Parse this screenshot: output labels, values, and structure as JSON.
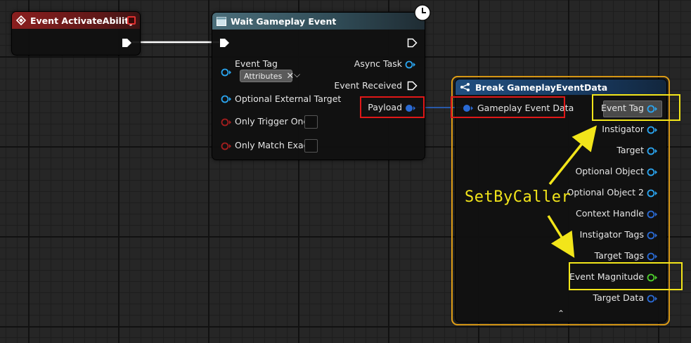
{
  "colors": {
    "event_header": "#7a1d1d",
    "wait_header": "#3e5e6a",
    "break_header": "#204a78",
    "selection_border": "#e8a417",
    "highlight_red": "#e01818",
    "highlight_yellow": "#f2e51a",
    "pin_blue": "#2aa5f0",
    "pin_green": "#4ed12c",
    "pin_red": "#a51e1e",
    "exec_white": "#ffffff"
  },
  "event_node": {
    "title": "Event ActivateAbility",
    "icon": "event-diamond-icon"
  },
  "wait_node": {
    "title": "Wait Gameplay Event",
    "icon": "function-icon",
    "latent_icon": "clock-icon",
    "event_tag_label": "Event Tag",
    "event_tag_value": "Attributes",
    "optional_external_target_label": "Optional External Target",
    "only_trigger_once_label": "Only Trigger Once",
    "only_match_exact_label": "Only Match Exact",
    "async_task_label": "Async Task",
    "event_received_label": "Event Received",
    "payload_label": "Payload"
  },
  "break_node": {
    "title": "Break GameplayEventData",
    "icon": "break-struct-icon",
    "input_label": "Gameplay Event Data",
    "outputs": [
      {
        "label": "Event Tag",
        "color": "#2aa5f0"
      },
      {
        "label": "Instigator",
        "color": "#2aa5f0"
      },
      {
        "label": "Target",
        "color": "#2aa5f0"
      },
      {
        "label": "Optional Object",
        "color": "#2aa5f0"
      },
      {
        "label": "Optional Object 2",
        "color": "#2aa5f0"
      },
      {
        "label": "Context Handle",
        "color": "#2a6ad4"
      },
      {
        "label": "Instigator Tags",
        "color": "#2a6ad4"
      },
      {
        "label": "Target Tags",
        "color": "#2a6ad4"
      },
      {
        "label": "Event Magnitude",
        "color": "#4ed12c"
      },
      {
        "label": "Target Data",
        "color": "#2a6ad4"
      }
    ],
    "collapse_icon": "chevron-up-icon"
  },
  "annotation": {
    "text": "SetByCaller"
  }
}
